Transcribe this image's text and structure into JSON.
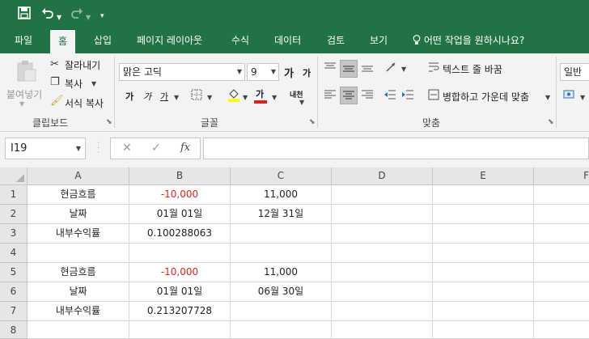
{
  "colors": {
    "accent": "#217346",
    "negative": "#e02020"
  },
  "qat": {
    "save_icon": "save-icon",
    "undo_icon": "undo-icon",
    "redo_icon": "redo-icon",
    "customize_icon": "chevron-down-icon"
  },
  "tabs": [
    {
      "label": "파일"
    },
    {
      "label": "홈"
    },
    {
      "label": "삽입"
    },
    {
      "label": "페이지 레이아웃"
    },
    {
      "label": "수식"
    },
    {
      "label": "데이터"
    },
    {
      "label": "검토"
    },
    {
      "label": "보기"
    }
  ],
  "tell_me": "어떤 작업을 원하시나요?",
  "ribbon": {
    "clipboard": {
      "paste": "붙여넣기",
      "cut": "잘라내기",
      "copy": "복사",
      "format_painter": "서식 복사",
      "label": "클립보드"
    },
    "font": {
      "font_name": "맑은 고딕",
      "font_size": "9",
      "grow": "가",
      "shrink": "가",
      "bold": "가",
      "italic": "가",
      "underline": "가",
      "highlight": "가",
      "font_color": "가",
      "phonetic": "내천",
      "label": "글꼴"
    },
    "alignment": {
      "wrap_text": "텍스트 줄 바꿈",
      "merge_center": "병합하고 가운데 맞춤",
      "label": "맞춤"
    },
    "number": {
      "format": "일반"
    }
  },
  "formula_bar": {
    "name_box": "I19",
    "cancel": "✕",
    "enter": "✓",
    "fx": "fx",
    "value": ""
  },
  "columns": [
    "A",
    "B",
    "C",
    "D",
    "E",
    "F"
  ],
  "rows": [
    {
      "num": "1",
      "cells": [
        "현금흐름",
        "-10,000",
        "11,000",
        "",
        "",
        ""
      ]
    },
    {
      "num": "2",
      "cells": [
        "날짜",
        "01월 01일",
        "12월 31일",
        "",
        "",
        ""
      ]
    },
    {
      "num": "3",
      "cells": [
        "내부수익률",
        "0.100288063",
        "",
        "",
        "",
        ""
      ]
    },
    {
      "num": "4",
      "cells": [
        "",
        "",
        "",
        "",
        "",
        ""
      ]
    },
    {
      "num": "5",
      "cells": [
        "현금흐름",
        "-10,000",
        "11,000",
        "",
        "",
        ""
      ]
    },
    {
      "num": "6",
      "cells": [
        "날짜",
        "01월 01일",
        "06월 30일",
        "",
        "",
        ""
      ]
    },
    {
      "num": "7",
      "cells": [
        "내부수익률",
        "0.213207728",
        "",
        "",
        "",
        ""
      ]
    },
    {
      "num": "8",
      "cells": [
        "",
        "",
        "",
        "",
        "",
        ""
      ]
    }
  ]
}
